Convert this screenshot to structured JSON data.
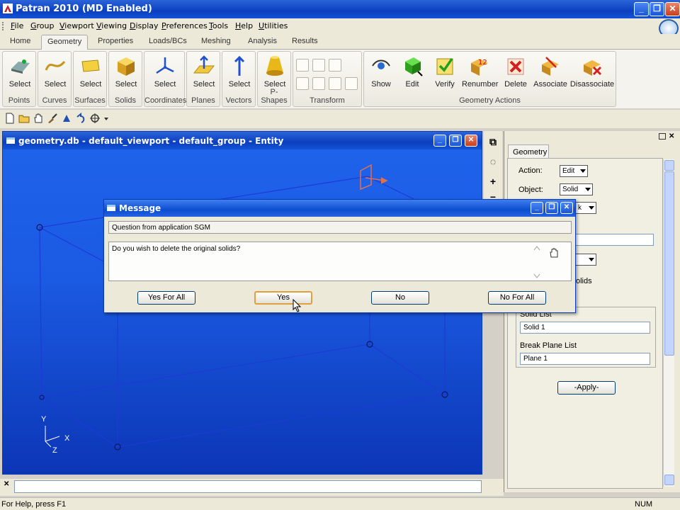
{
  "app": {
    "title": "Patran 2010 (MD Enabled)"
  },
  "window_controls": {
    "minimize": "_",
    "restore": "❐",
    "close": "✕"
  },
  "menu": [
    {
      "label": "File",
      "key": "F",
      "rest": "ile"
    },
    {
      "label": "Group",
      "key": "G",
      "rest": "roup"
    },
    {
      "label": "Viewport",
      "key": "V",
      "rest": "iewport"
    },
    {
      "label": "Viewing",
      "key": "V",
      "rest": "iewing"
    },
    {
      "label": "Display",
      "key": "D",
      "rest": "isplay"
    },
    {
      "label": "Preferences",
      "key": "P",
      "rest": "references"
    },
    {
      "label": "Tools",
      "key": "T",
      "rest": "ools"
    },
    {
      "label": "Help",
      "key": "H",
      "rest": "elp"
    },
    {
      "label": "Utilities",
      "key": "U",
      "rest": "tilities"
    }
  ],
  "ribbon_tabs": [
    "Home",
    "Geometry",
    "Properties",
    "Loads/BCs",
    "Meshing",
    "Analysis",
    "Results"
  ],
  "ribbon_groups": {
    "points": {
      "button": "Select",
      "label": "Points"
    },
    "curves": {
      "button": "Select",
      "label": "Curves"
    },
    "surfaces": {
      "button": "Select",
      "label": "Surfaces"
    },
    "solids": {
      "button": "Select",
      "label": "Solids"
    },
    "coordinates": {
      "button": "Select",
      "label": "Coordinates"
    },
    "planes": {
      "button": "Select",
      "label": "Planes"
    },
    "vectors": {
      "button": "Select",
      "label": "Vectors"
    },
    "pshapes": {
      "button": "Select",
      "label": "P-Shapes"
    },
    "transform": {
      "label": "Transform"
    },
    "geometry_actions": {
      "label": "Geometry Actions",
      "buttons": [
        "Show",
        "Edit",
        "Verify",
        "Renumber",
        "Delete",
        "Associate",
        "Disassociate"
      ]
    }
  },
  "viewport": {
    "title": "geometry.db - default_viewport - default_group - Entity",
    "axes": {
      "x": "X",
      "y": "Y",
      "z": "Z"
    }
  },
  "side_toolbar": {
    "plus": "+",
    "minus": "−"
  },
  "panel": {
    "tab": "Geometry",
    "action_label": "Action:",
    "action_value": "Edit",
    "object_label": "Object:",
    "object_value": "Solid",
    "method_fragment": "k",
    "option_fragment": "olids",
    "solid_list_label": "Solid List",
    "solid_list_value": "Solid 1",
    "break_plane_label": "Break Plane List",
    "break_plane_value": "Plane 1",
    "apply": "-Apply-"
  },
  "dialog": {
    "title": "Message",
    "source": "Question from application SGM",
    "question": "Do you wish to delete the original solids?",
    "buttons": {
      "yes_all": "Yes For All",
      "yes": "Yes",
      "no": "No",
      "no_all": "No For All"
    }
  },
  "statusbar": {
    "help": "For Help, press F1",
    "num": "NUM"
  },
  "colors": {
    "titlebar": "#0b3fbf",
    "viewport_bg": "#1b5ae2",
    "wire": "#1e3ad6",
    "chrome": "#ece9d8"
  }
}
